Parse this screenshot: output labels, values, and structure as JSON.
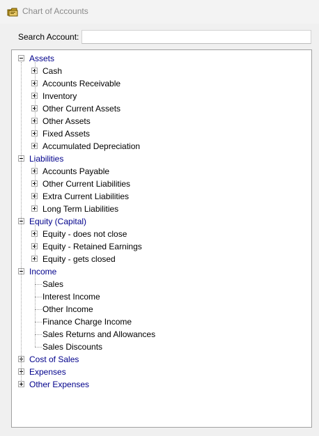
{
  "window": {
    "title": "Chart of Accounts",
    "icon": "folder-accounts-icon"
  },
  "search": {
    "label": "Search Account:",
    "value": "",
    "placeholder": ""
  },
  "colors": {
    "category_text": "#00008b",
    "item_text": "#000000",
    "tree_line": "#a0a0a0"
  },
  "tree": [
    {
      "label": "Assets",
      "expanded": true,
      "children": [
        {
          "label": "Cash",
          "has_children": true
        },
        {
          "label": "Accounts Receivable",
          "has_children": true
        },
        {
          "label": "Inventory",
          "has_children": true
        },
        {
          "label": "Other Current Assets",
          "has_children": true
        },
        {
          "label": "Other Assets",
          "has_children": true
        },
        {
          "label": "Fixed Assets",
          "has_children": true
        },
        {
          "label": "Accumulated Depreciation",
          "has_children": true
        }
      ]
    },
    {
      "label": "Liabilities",
      "expanded": true,
      "children": [
        {
          "label": "Accounts Payable",
          "has_children": true
        },
        {
          "label": "Other Current Liabilities",
          "has_children": true
        },
        {
          "label": "Extra Current Liabilities",
          "has_children": true
        },
        {
          "label": "Long Term Liabilities",
          "has_children": true
        }
      ]
    },
    {
      "label": "Equity (Capital)",
      "expanded": true,
      "children": [
        {
          "label": "Equity - does not close",
          "has_children": true
        },
        {
          "label": "Equity - Retained Earnings",
          "has_children": true
        },
        {
          "label": "Equity - gets closed",
          "has_children": true
        }
      ]
    },
    {
      "label": "Income",
      "expanded": true,
      "children": [
        {
          "label": "Sales",
          "has_children": false
        },
        {
          "label": "Interest  Income",
          "has_children": false
        },
        {
          "label": "Other Income",
          "has_children": false
        },
        {
          "label": "Finance Charge Income",
          "has_children": false
        },
        {
          "label": "Sales Returns and Allowances",
          "has_children": false
        },
        {
          "label": "Sales Discounts",
          "has_children": false
        }
      ]
    },
    {
      "label": "Cost of Sales",
      "expanded": false,
      "children": []
    },
    {
      "label": "Expenses",
      "expanded": false,
      "children": []
    },
    {
      "label": "Other Expenses",
      "expanded": false,
      "children": []
    }
  ]
}
